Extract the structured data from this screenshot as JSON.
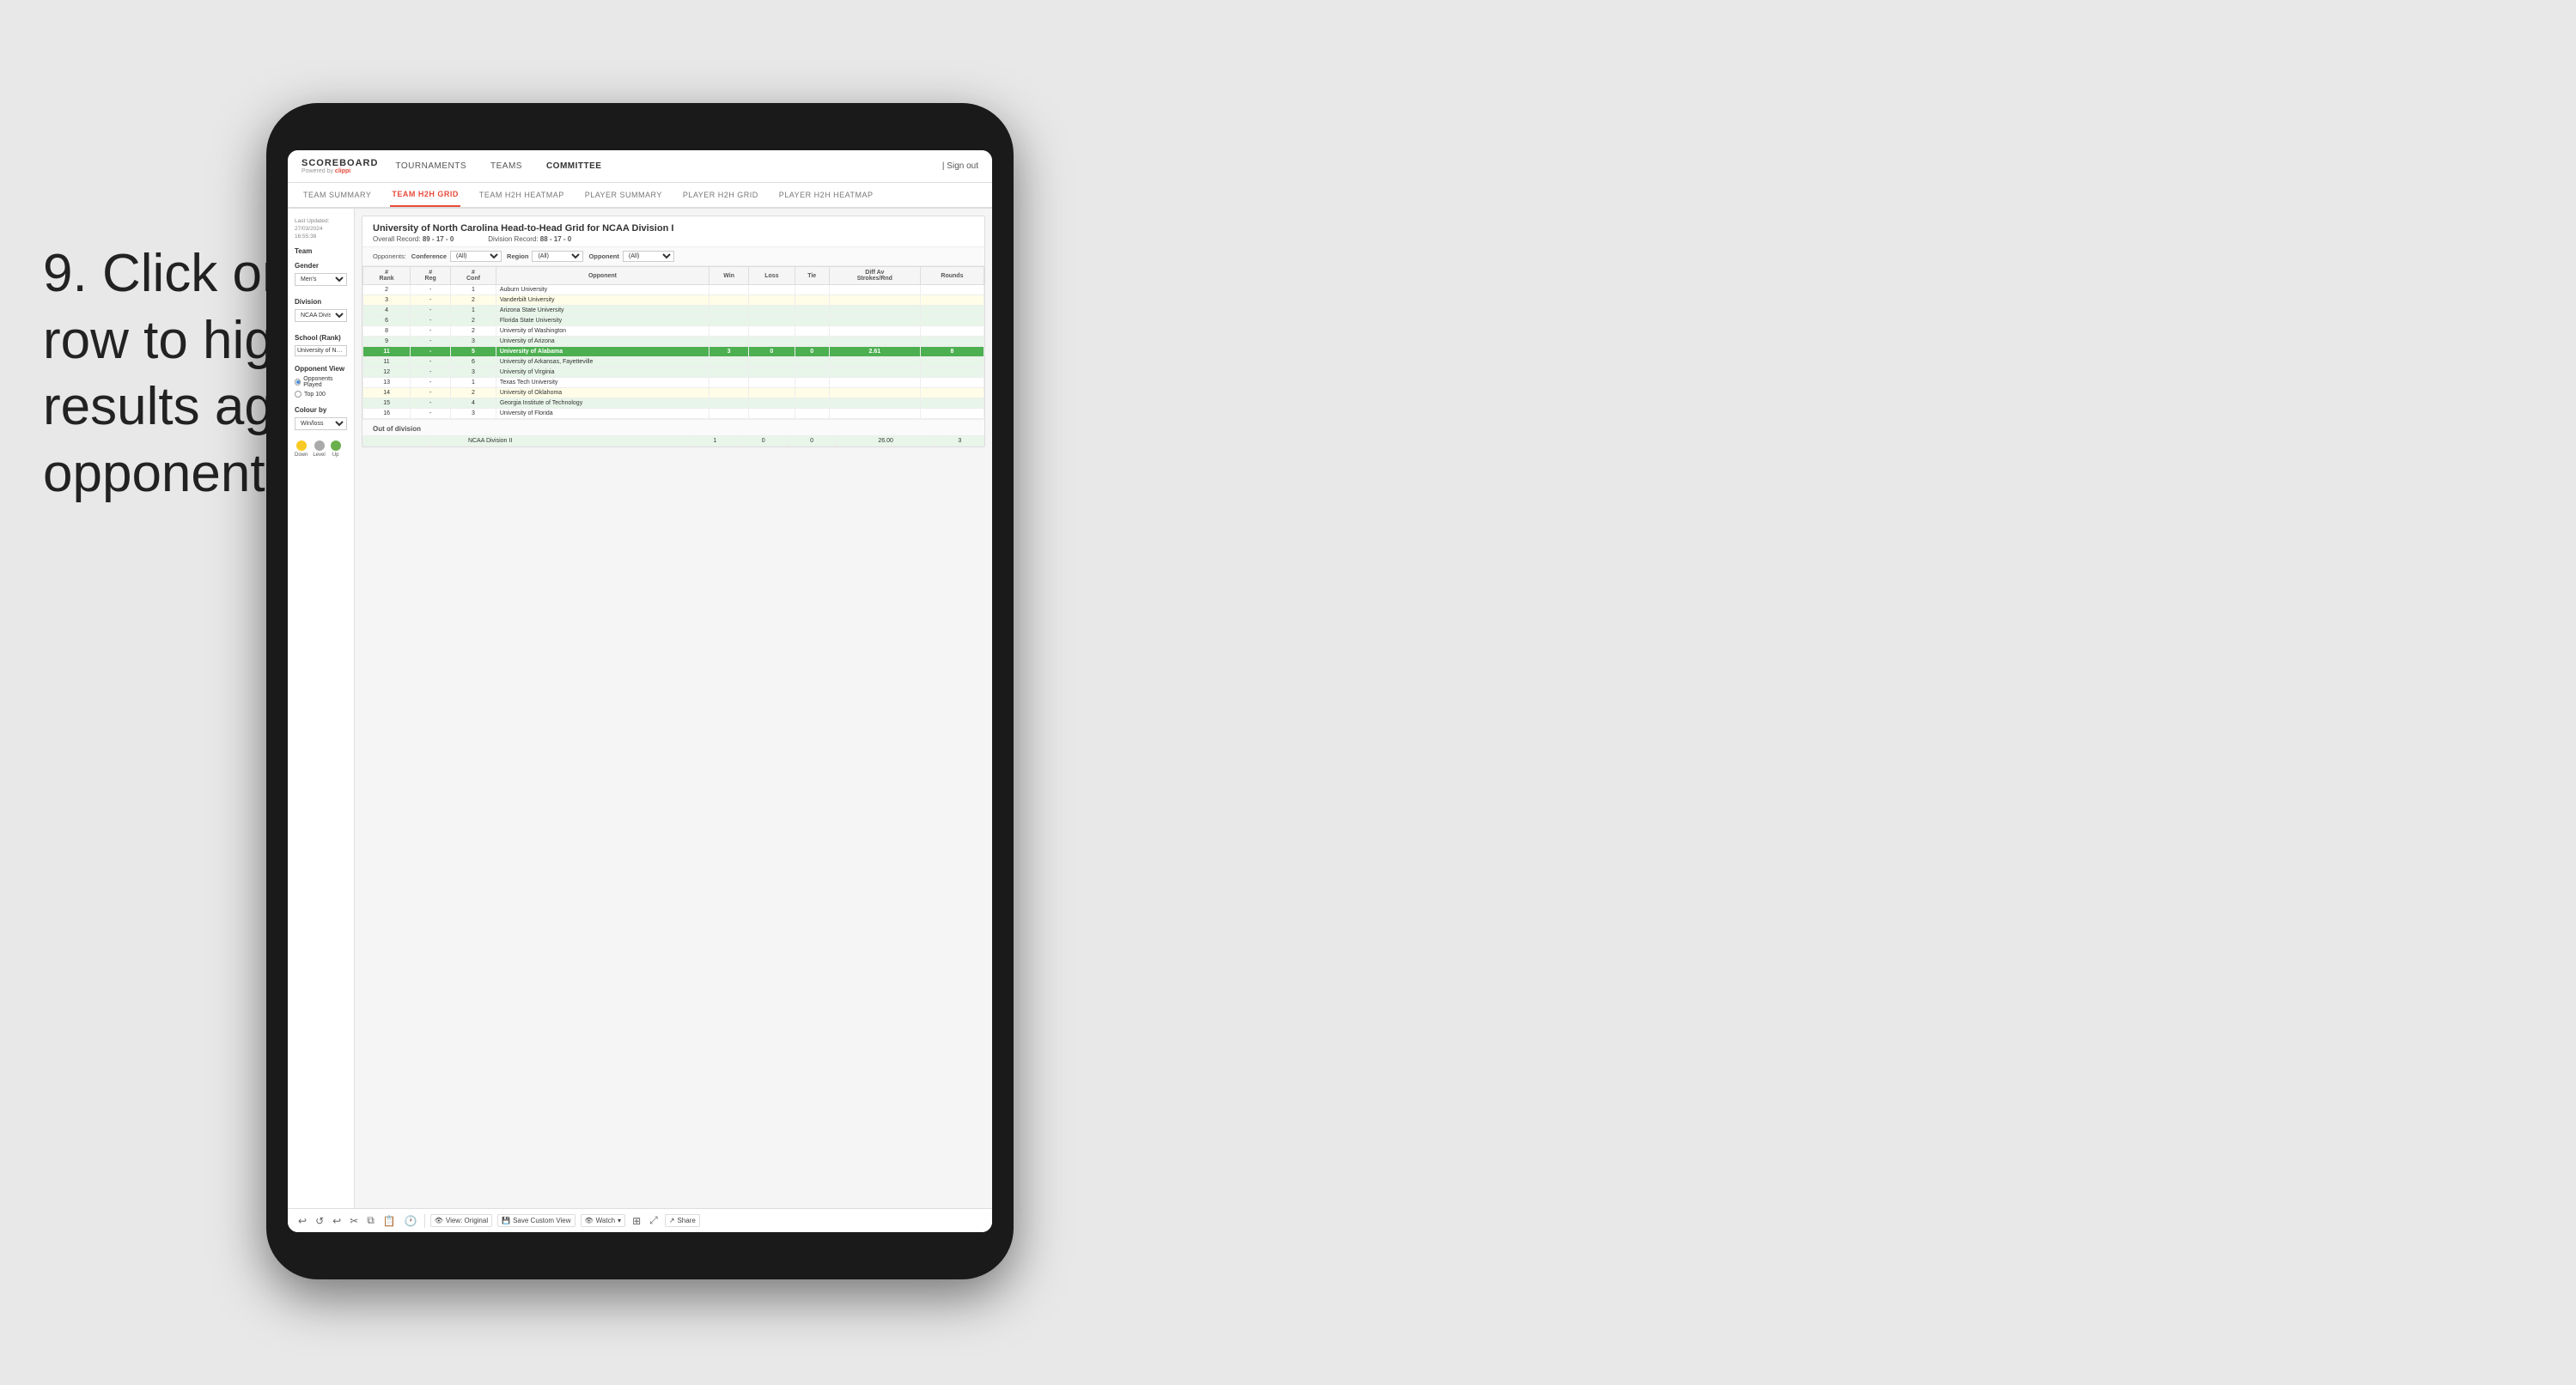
{
  "instruction": {
    "step": "9.",
    "text": "Click on a team's row to highlight results against that opponent"
  },
  "app": {
    "logo": "SCOREBOARD",
    "powered_by": "Powered by",
    "brand": "clippi",
    "sign_out": "Sign out"
  },
  "nav": {
    "items": [
      "TOURNAMENTS",
      "TEAMS",
      "COMMITTEE"
    ]
  },
  "sub_nav": {
    "items": [
      "TEAM SUMMARY",
      "TEAM H2H GRID",
      "TEAM H2H HEATMAP",
      "PLAYER SUMMARY",
      "PLAYER H2H GRID",
      "PLAYER H2H HEATMAP"
    ],
    "active": "TEAM H2H GRID"
  },
  "sidebar": {
    "last_updated": "Last Updated: 27/03/2024\n16:55:38",
    "team_label": "Team",
    "gender_label": "Gender",
    "gender_value": "Men's",
    "division_label": "Division",
    "division_value": "NCAA Division I",
    "school_label": "School (Rank)",
    "school_value": "University of Nort...",
    "opponent_view_label": "Opponent View",
    "opponent_options": [
      "Opponents Played",
      "Top 100"
    ],
    "colour_by_label": "Colour by",
    "colour_by_value": "Win/loss",
    "legend": [
      {
        "label": "Down",
        "color": "#f9ca24"
      },
      {
        "label": "Level",
        "color": "#aaa"
      },
      {
        "label": "Up",
        "color": "#6ab04c"
      }
    ]
  },
  "panel": {
    "title": "University of North Carolina Head-to-Head Grid for NCAA Division I",
    "overall_record_label": "Overall Record:",
    "overall_record": "89 - 17 - 0",
    "division_record_label": "Division Record:",
    "division_record": "88 - 17 - 0",
    "filters": {
      "opponents_label": "Opponents:",
      "conference_label": "Conference",
      "conference_value": "(All)",
      "region_label": "Region",
      "region_value": "(All)",
      "opponent_label": "Opponent",
      "opponent_value": "(All)"
    },
    "table_headers": [
      "#\nRank",
      "#\nReg",
      "#\nConf",
      "Opponent",
      "Win",
      "Loss",
      "Tie",
      "Diff Av\nStrokes/Rnd",
      "Rounds"
    ],
    "rows": [
      {
        "rank": "2",
        "reg": "-",
        "conf": "1",
        "opponent": "Auburn University",
        "win": "",
        "loss": "",
        "tie": "",
        "diff": "",
        "rounds": "",
        "style": ""
      },
      {
        "rank": "3",
        "reg": "-",
        "conf": "2",
        "opponent": "Vanderbilt University",
        "win": "",
        "loss": "",
        "tie": "",
        "diff": "",
        "rounds": "",
        "style": "light-yellow"
      },
      {
        "rank": "4",
        "reg": "-",
        "conf": "1",
        "opponent": "Arizona State University",
        "win": "",
        "loss": "",
        "tie": "",
        "diff": "",
        "rounds": "",
        "style": "light-green"
      },
      {
        "rank": "6",
        "reg": "-",
        "conf": "2",
        "opponent": "Florida State University",
        "win": "",
        "loss": "",
        "tie": "",
        "diff": "",
        "rounds": "",
        "style": "light-green"
      },
      {
        "rank": "8",
        "reg": "-",
        "conf": "2",
        "opponent": "University of Washington",
        "win": "",
        "loss": "",
        "tie": "",
        "diff": "",
        "rounds": "",
        "style": ""
      },
      {
        "rank": "9",
        "reg": "-",
        "conf": "3",
        "opponent": "University of Arizona",
        "win": "",
        "loss": "",
        "tie": "",
        "diff": "",
        "rounds": "",
        "style": "light-green"
      },
      {
        "rank": "11",
        "reg": "-",
        "conf": "5",
        "opponent": "University of Alabama",
        "win": "3",
        "loss": "0",
        "tie": "0",
        "diff": "2.61",
        "rounds": "8",
        "style": "highlighted"
      },
      {
        "rank": "11",
        "reg": "-",
        "conf": "6",
        "opponent": "University of Arkansas, Fayetteville",
        "win": "",
        "loss": "",
        "tie": "",
        "diff": "",
        "rounds": "",
        "style": "light-green"
      },
      {
        "rank": "12",
        "reg": "-",
        "conf": "3",
        "opponent": "University of Virginia",
        "win": "",
        "loss": "",
        "tie": "",
        "diff": "",
        "rounds": "",
        "style": "light-green"
      },
      {
        "rank": "13",
        "reg": "-",
        "conf": "1",
        "opponent": "Texas Tech University",
        "win": "",
        "loss": "",
        "tie": "",
        "diff": "",
        "rounds": "",
        "style": ""
      },
      {
        "rank": "14",
        "reg": "-",
        "conf": "2",
        "opponent": "University of Oklahoma",
        "win": "",
        "loss": "",
        "tie": "",
        "diff": "",
        "rounds": "",
        "style": "light-yellow"
      },
      {
        "rank": "15",
        "reg": "-",
        "conf": "4",
        "opponent": "Georgia Institute of Technology",
        "win": "",
        "loss": "",
        "tie": "",
        "diff": "",
        "rounds": "",
        "style": "light-green"
      },
      {
        "rank": "16",
        "reg": "-",
        "conf": "3",
        "opponent": "University of Florida",
        "win": "",
        "loss": "",
        "tie": "",
        "diff": "",
        "rounds": "",
        "style": ""
      }
    ],
    "out_of_division_label": "Out of division",
    "out_of_division_row": {
      "division": "NCAA Division II",
      "win": "1",
      "loss": "0",
      "tie": "0",
      "diff": "26.00",
      "rounds": "3"
    }
  },
  "toolbar": {
    "view_label": "View: Original",
    "save_custom": "Save Custom View",
    "watch": "Watch",
    "share": "Share"
  }
}
